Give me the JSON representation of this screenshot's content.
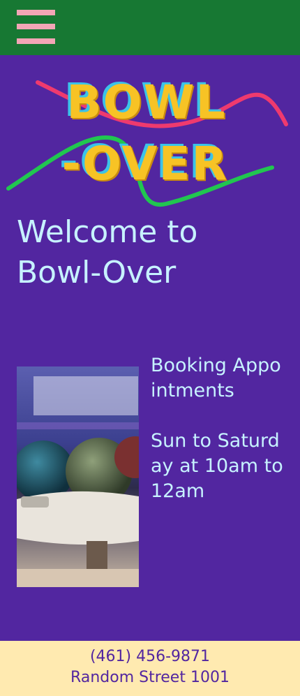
{
  "header": {
    "menu_icon": "hamburger-menu-icon",
    "menu_color": "#f3a6b6",
    "background": "#177833"
  },
  "logo": {
    "line1": "BOWL",
    "line2": "-OVER",
    "fill_color": "#f7c325",
    "outline_color": "#3bc3e8",
    "squiggle_colors": [
      "#ef3a6e",
      "#21c650"
    ]
  },
  "hero": {
    "title": "Welcome to Bowl-Over"
  },
  "content": {
    "image_alt": "bowling-balls-photo",
    "booking_label": "Booking Appointments",
    "hours": "Sun to Saturday at 10am to 12am"
  },
  "footer": {
    "phone": "(461) 456-9871",
    "address": "Random Street 1001",
    "background": "#ffeab0"
  },
  "theme": {
    "page_background": "#5226a0",
    "text_color": "#c7f2ff"
  }
}
